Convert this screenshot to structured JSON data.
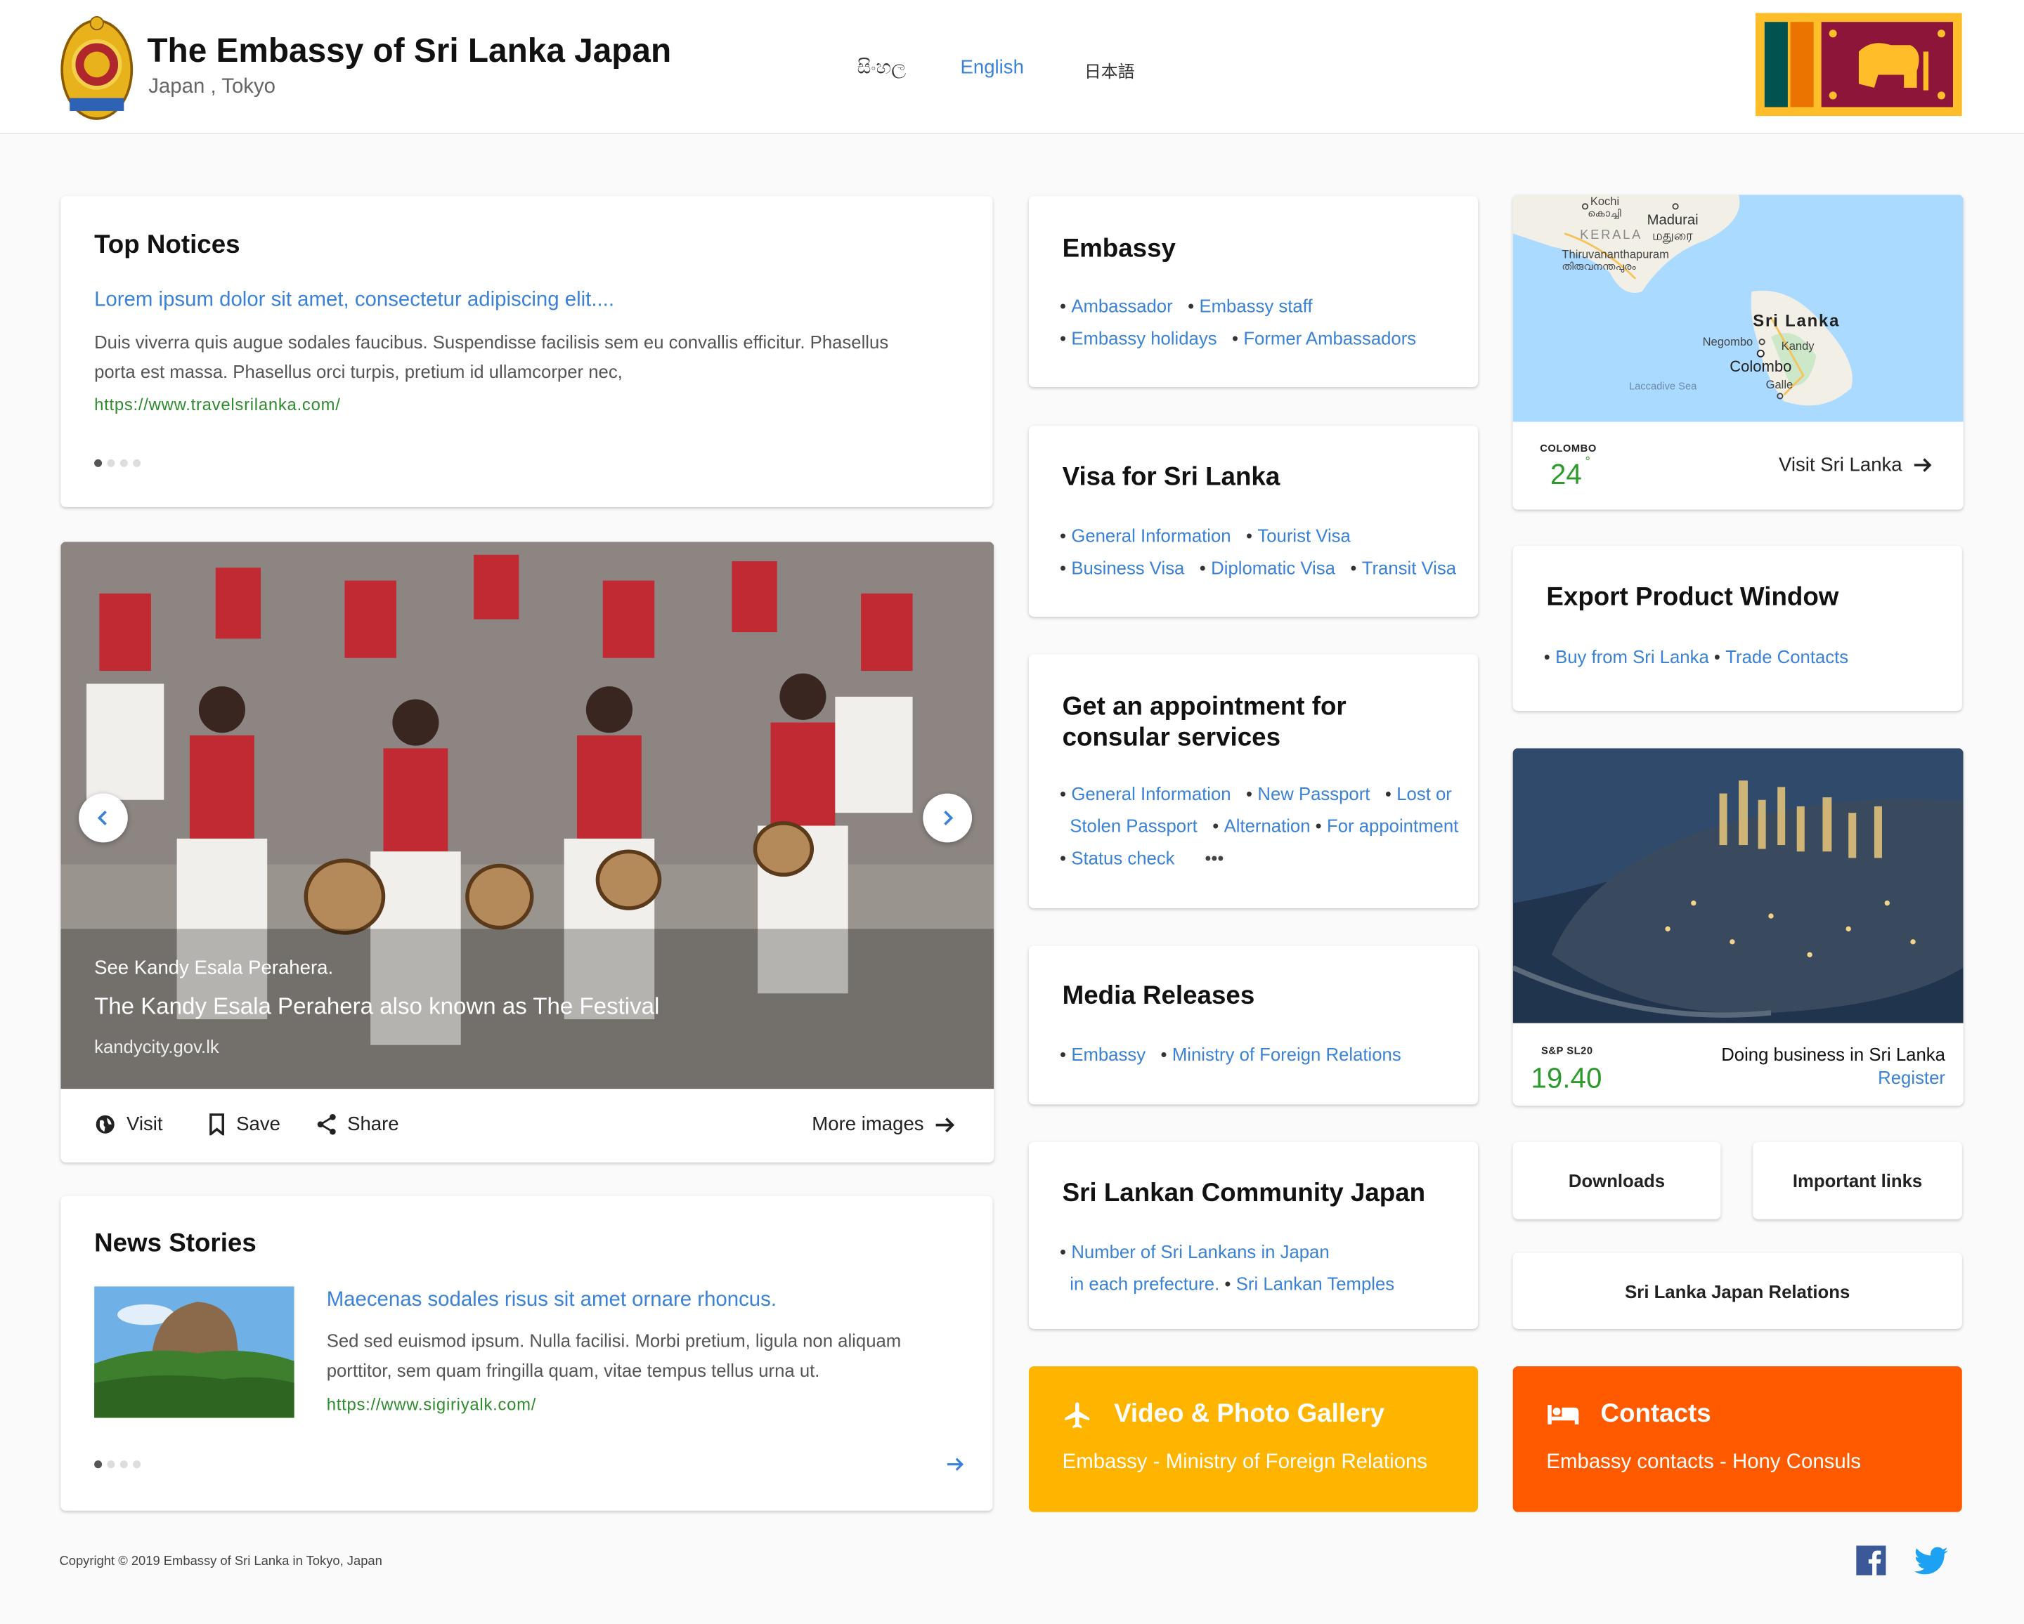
{
  "header": {
    "title": "The Embassy of Sri Lanka Japan",
    "subtitle": "Japan , Tokyo",
    "languages": [
      "සිංහල",
      "English",
      "日本語"
    ],
    "active_language": "English"
  },
  "top_notices": {
    "title": "Top Notices",
    "link": "Lorem ipsum dolor sit amet, consectetur adipiscing elit....",
    "body": "Duis viverra quis augue sodales faucibus. Suspendisse facilisis sem eu convallis efficitur. Phasellus porta est massa. Phasellus orci turpis, pretium id ullamcorper nec,",
    "url": "https://www.travelsrilanka.com/"
  },
  "hero": {
    "caption1": "See Kandy Esala Perahera.",
    "caption2": "The Kandy Esala Perahera also known as The Festival",
    "caption3": "kandycity.gov.lk",
    "actions": {
      "visit": "Visit",
      "save": "Save",
      "share": "Share",
      "more": "More images"
    }
  },
  "news": {
    "title": "News Stories",
    "link": "Maecenas sodales risus sit amet ornare rhoncus.",
    "body": "Sed sed euismod ipsum. Nulla facilisi. Morbi pretium, ligula non aliquam porttitor, sem quam fringilla quam, vitae tempus tellus urna ut.",
    "url": "https://www.sigiriyalk.com/"
  },
  "embassy": {
    "title": "Embassy",
    "links": [
      "Ambassador",
      "Embassy staff",
      "Embassy holidays",
      "Former Ambassadors"
    ]
  },
  "visa": {
    "title": "Visa for Sri Lanka",
    "links": [
      "General Information",
      "Tourist Visa",
      "Business Visa",
      "Diplomatic Visa",
      "Transit Visa"
    ]
  },
  "appointment": {
    "title_line1": "Get an appointment for",
    "title_line2": "consular services",
    "links": [
      "General Information",
      "New Passport",
      "Lost or",
      "Stolen Passport",
      "Alternation",
      "For appointment",
      "Status check"
    ],
    "more": "•••"
  },
  "media": {
    "title": "Media Releases",
    "links": [
      "Embassy",
      "Ministry of Foreign Relations"
    ]
  },
  "community": {
    "title": "Sri Lankan Community Japan",
    "links": [
      "Number of Sri Lankans in Japan",
      "in each prefecture.",
      "Sri Lankan Temples"
    ]
  },
  "map": {
    "labels": {
      "kochi": "Kochi",
      "kochi_local": "കൊച്ചി",
      "madurai": "Madurai",
      "madurai_local": "மதுரை",
      "kerala": "KERALA",
      "tvm": "Thiruvananthapuram",
      "tvm_local": "തിരുവനന്തപുരം",
      "srilanka": "Sri Lanka",
      "negombo": "Negombo",
      "kandy": "Kandy",
      "colombo": "Colombo",
      "laccadive": "Laccadive Sea",
      "galle": "Galle"
    },
    "city": "COLOMBO",
    "temperature": "24",
    "degree": "°",
    "visit": "Visit Sri Lanka"
  },
  "export": {
    "title": "Export Product Window",
    "links": [
      "Buy from Sri Lanka",
      "Trade Contacts"
    ]
  },
  "business": {
    "index_label": "S&P  SL20",
    "index_value": "19.40",
    "title": "Doing business in Sri Lanka",
    "register": "Register"
  },
  "quick_links": {
    "downloads": "Downloads",
    "important": "Important links",
    "relations": "Sri Lanka Japan Relations"
  },
  "gallery": {
    "title": "Video & Photo Gallery",
    "subtitle": "Embassy - Ministry of Foreign Relations"
  },
  "contacts": {
    "title": "Contacts",
    "subtitle": "Embassy contacts - Hony Consuls"
  },
  "footer": {
    "copyright": "Copyright © 2019 Embassy of Sri Lanka in Tokyo, Japan"
  },
  "colors": {
    "link": "#3b82d6",
    "url_green": "#2e8b2e",
    "gallery": "#ffb400",
    "contacts": "#ff5a00"
  }
}
